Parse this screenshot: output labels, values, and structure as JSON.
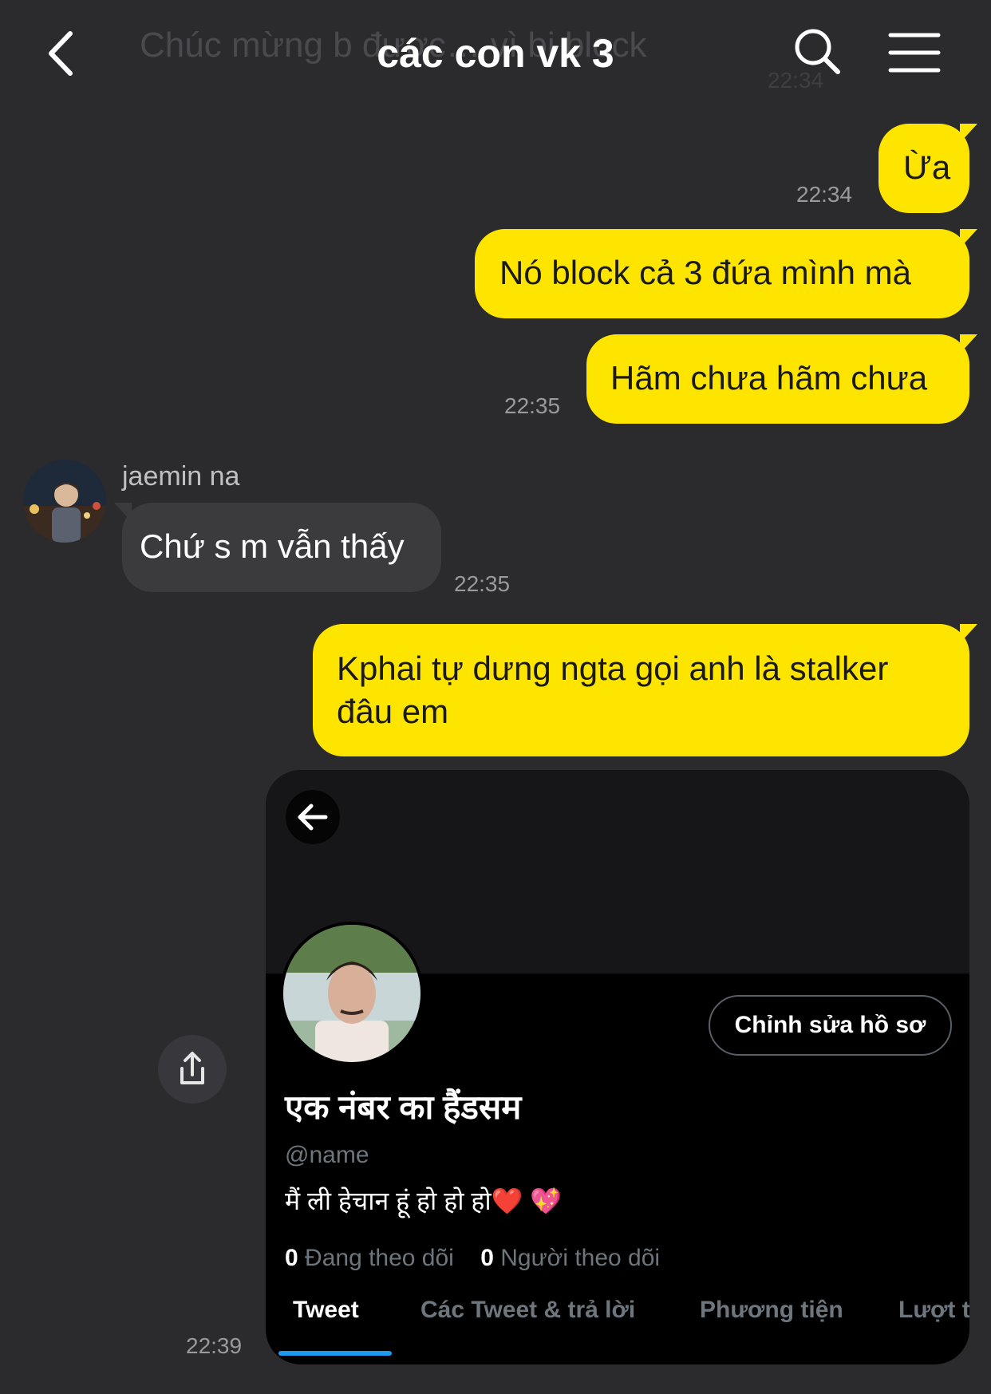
{
  "header": {
    "ghost_preview": "Chúc mừng b được… vì bị block",
    "ghost_time": "22:34",
    "title": "các con vk 3",
    "icons": {
      "back": "chevron-left-icon",
      "search": "search-icon",
      "menu": "menu-icon"
    }
  },
  "messages": [
    {
      "from": "me",
      "text": "Ừa",
      "time": "22:34"
    },
    {
      "from": "me",
      "text": "Nó block cả 3 đứa mình mà",
      "time": ""
    },
    {
      "from": "me",
      "text": "Hãm chưa hãm chưa",
      "time": "22:35"
    },
    {
      "from": "other",
      "sender": "jaemin na",
      "text": "Chứ s m vẫn thấy",
      "time": "22:35"
    },
    {
      "from": "me",
      "text_line1": "Kphai tự dưng ngta gọi anh là stalker",
      "text_line2": "đâu em",
      "time": ""
    },
    {
      "from": "me",
      "type": "image",
      "time": "22:39"
    }
  ],
  "screenshot": {
    "back_icon": "arrow-left-icon",
    "edit_button": "Chỉnh sửa hồ sơ",
    "display_name": "एक नंबर का हैंडसम",
    "handle": "@name",
    "bio": "मैं ली हेचान हूं हो हो हो❤️ 💖",
    "following_count": "0",
    "following_label": "Đang theo dõi",
    "followers_count": "0",
    "followers_label": "Người theo dõi",
    "tabs": [
      "Tweet",
      "Các Tweet & trả lời",
      "Phương tiện",
      "Lượt t"
    ]
  },
  "share_icon": "share-icon",
  "colors": {
    "background": "#2b2b2e",
    "my_bubble": "#fee500",
    "other_bubble": "#3b3b3e",
    "tab_indicator": "#1d9bf0"
  }
}
